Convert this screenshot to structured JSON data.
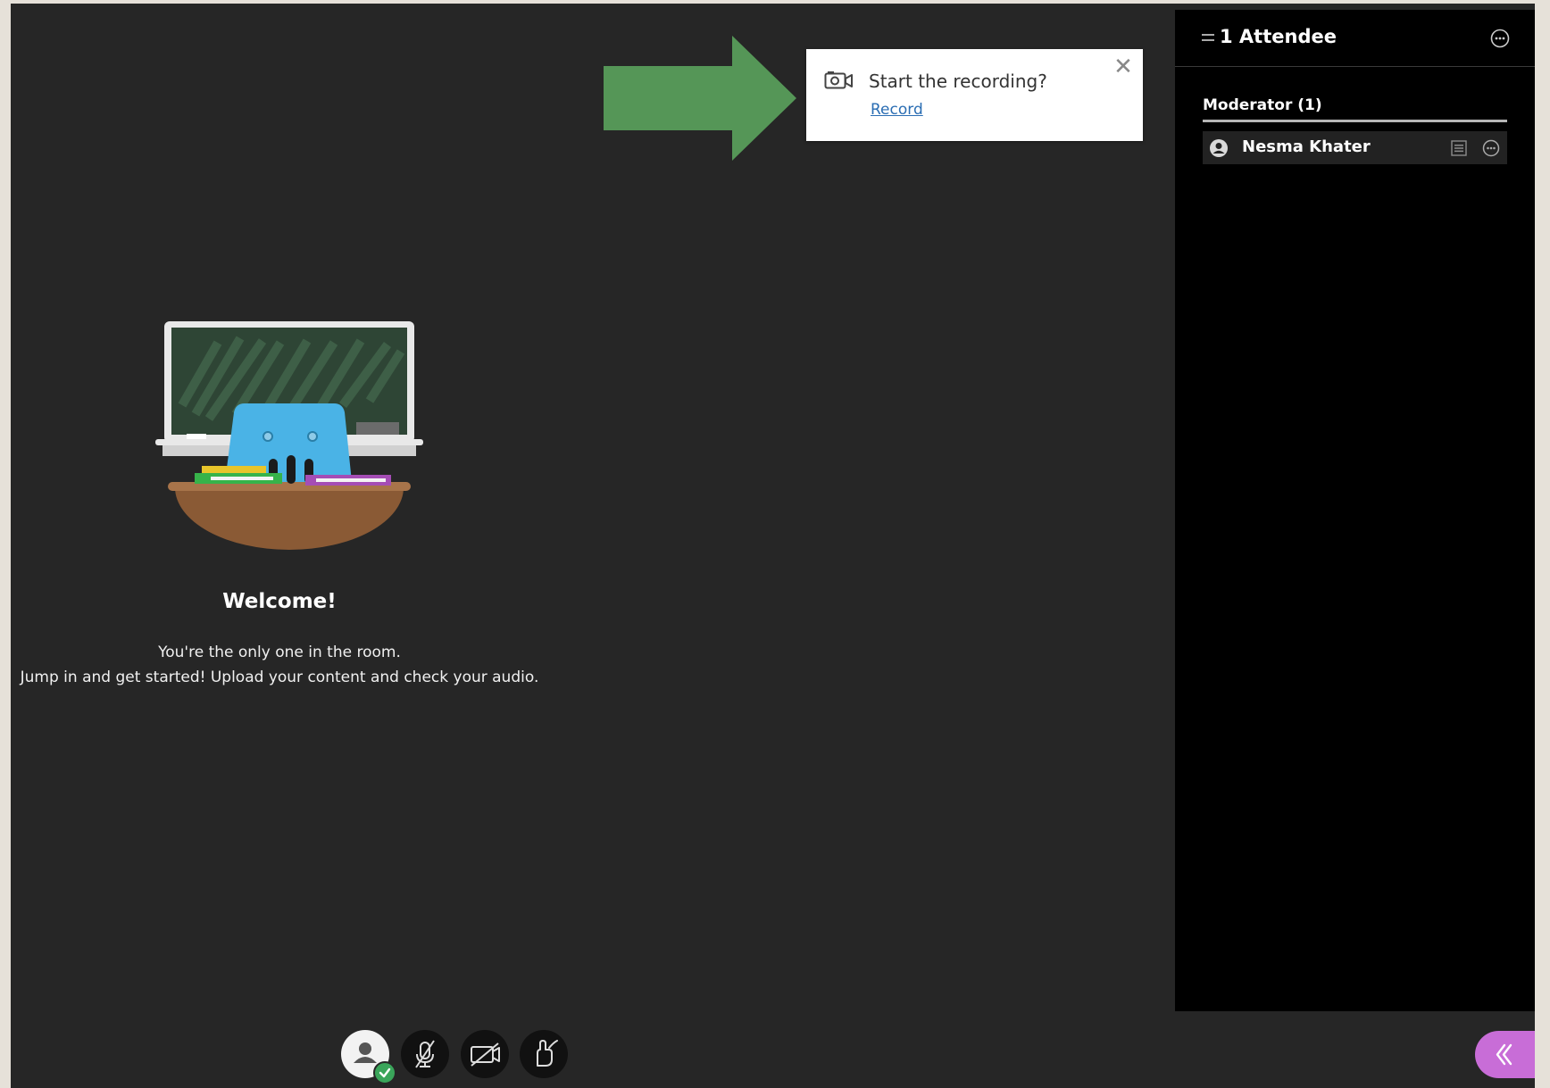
{
  "recording_prompt": {
    "title": "Start the recording?",
    "link_label": "Record",
    "close_glyph": "✕",
    "camera_icon": "camera-icon"
  },
  "welcome": {
    "title": "Welcome!",
    "line1": "You're the only one in the room.",
    "line2": "Jump in and get started! Upload your content and check your audio."
  },
  "attendees_panel": {
    "title": "1 Attendee",
    "groups": [
      {
        "label": "Moderator (1)",
        "members": [
          {
            "name": "Nesma Khater"
          }
        ]
      }
    ]
  },
  "controls": {
    "items": [
      "my-status-button",
      "microphone-off-button",
      "camera-off-button",
      "raise-hand-button"
    ]
  },
  "colors": {
    "stage_bg": "#262626",
    "panel_bg": "#000000",
    "arrow": "#559657",
    "link": "#2a6db3",
    "collab_tab": "#c86dd7",
    "status_ok": "#3aa55a"
  }
}
